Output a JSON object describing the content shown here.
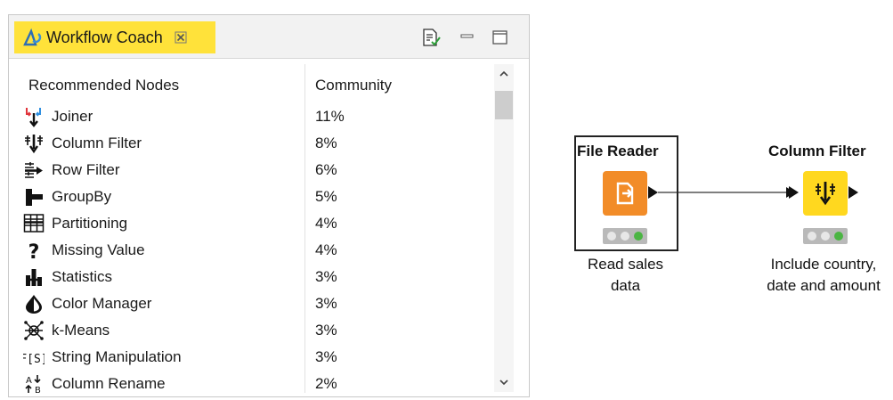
{
  "panel": {
    "tab_title": "Workflow Coach",
    "columns": {
      "name": "Recommended Nodes",
      "value": "Community"
    },
    "rows": [
      {
        "icon": "joiner-icon",
        "name": "Joiner",
        "value": "11%"
      },
      {
        "icon": "column-filter-icon",
        "name": "Column Filter",
        "value": "8%"
      },
      {
        "icon": "row-filter-icon",
        "name": "Row Filter",
        "value": "6%"
      },
      {
        "icon": "groupby-icon",
        "name": "GroupBy",
        "value": "5%"
      },
      {
        "icon": "partitioning-icon",
        "name": "Partitioning",
        "value": "4%"
      },
      {
        "icon": "missing-value-icon",
        "name": "Missing Value",
        "value": "4%"
      },
      {
        "icon": "statistics-icon",
        "name": "Statistics",
        "value": "3%"
      },
      {
        "icon": "color-manager-icon",
        "name": "Color Manager",
        "value": "3%"
      },
      {
        "icon": "k-means-icon",
        "name": "k-Means",
        "value": "3%"
      },
      {
        "icon": "string-manipulation-icon",
        "name": "String Manipulation",
        "value": "3%"
      },
      {
        "icon": "column-rename-icon",
        "name": "Column Rename",
        "value": "2%"
      }
    ]
  },
  "workflow": {
    "nodes": [
      {
        "id": "file-reader",
        "title": "File Reader",
        "label_lines": [
          "Read sales",
          "data"
        ],
        "color": "#f28c28",
        "selected": true
      },
      {
        "id": "column-filter",
        "title": "Column Filter",
        "label_lines": [
          "Include country,",
          "date and amount"
        ],
        "color": "#ffd81f",
        "selected": false
      }
    ]
  },
  "colors": {
    "tab_highlight": "#ffe23a",
    "status_ok": "#4bb543"
  }
}
